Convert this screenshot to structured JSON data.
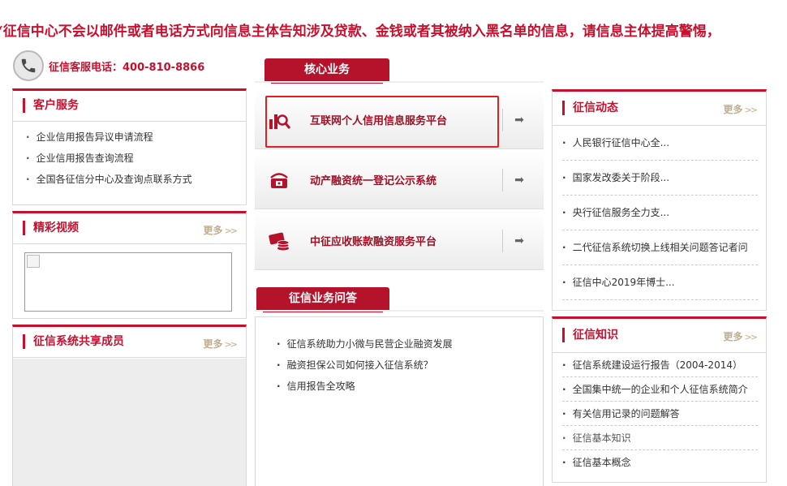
{
  "banner": {
    "text": "“征信中心不会以邮件或者电话方式向信息主体告知涉及贷款、金钱或者其被纳入黑名单的信息，请信息主体提高警惕，"
  },
  "hotline": {
    "text": "征信客服电话：400-810-8866"
  },
  "customer_service": {
    "title": "客户服务",
    "items": [
      "企业信用报告异议申请流程",
      "企业信用报告查询流程",
      "全国各征信分中心及查询点联系方式"
    ]
  },
  "videos": {
    "title": "精彩视频",
    "more": "更多"
  },
  "members": {
    "title": "征信系统共享成员",
    "more": "更多"
  },
  "core": {
    "tab": "核心业务",
    "items": [
      {
        "label": "互联网个人信用信息服务平台",
        "icon": "magnifier-chart-icon"
      },
      {
        "label": "动产融资统一登记公示系统",
        "icon": "registration-icon"
      },
      {
        "label": "中征应收账款融资服务平台",
        "icon": "card-coins-icon"
      }
    ],
    "arrow": "➡"
  },
  "qa": {
    "tab": "征信业务问答",
    "items": [
      "征信系统助力小微与民营企业融资发展",
      "融资担保公司如何接入征信系统？",
      "信用报告全攻略"
    ]
  },
  "news": {
    "title": "征信动态",
    "more": "更多",
    "items": [
      "人民银行征信中心全...",
      "国家发改委关于阶段...",
      "央行征信服务全力支...",
      "二代征信系统切换上线相关问题答记者问",
      "征信中心2019年博士..."
    ]
  },
  "knowledge": {
    "title": "征信知识",
    "more": "更多",
    "items": [
      "征信系统建设运行报告（2004-2014）",
      "全国集中统一的企业和个人征信系统简介",
      "有关信用记录的问题解答",
      "征信基本知识",
      "征信基本概念"
    ]
  },
  "colors": {
    "accent": "#c8102e",
    "tab": "#b5132c",
    "more": "#bfae8f"
  }
}
